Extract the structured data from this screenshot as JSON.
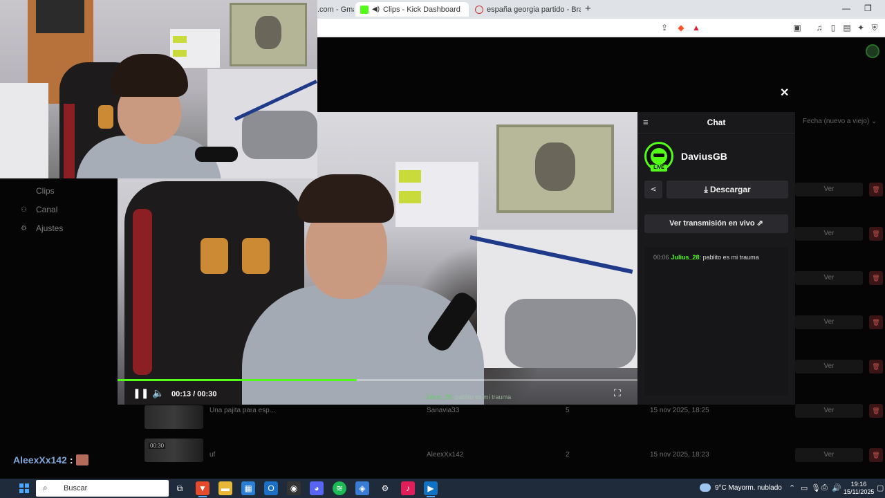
{
  "browser": {
    "tabs": [
      {
        "label": ".com - Gmail",
        "active": false
      },
      {
        "label": "Clips - Kick Dashboard",
        "active": true
      },
      {
        "label": "españa georgia partido - Brave Search",
        "active": false
      }
    ]
  },
  "sidebar": {
    "items": [
      {
        "label": "Clips",
        "icon": "clips-icon"
      },
      {
        "label": "Canal",
        "icon": "people-icon"
      },
      {
        "label": "Ajustes",
        "icon": "gear-icon"
      }
    ]
  },
  "table": {
    "sort_label": "Fecha (nuevo a viejo)",
    "view_label": "Ver",
    "rows": [
      {
        "thumb_time": "",
        "title": "Una pajita para esp...",
        "author": "Sanavia33",
        "views": "5",
        "date": "15 nov 2025, 18:25"
      },
      {
        "thumb_time": "00:30",
        "title": "uf",
        "author": "AleexXx142",
        "views": "2",
        "date": "15 nov 2025, 18:23"
      }
    ]
  },
  "player": {
    "time": "00:13 / 00:30",
    "progress": 0.46,
    "overlay_user": "Julius_28:",
    "overlay_text": "pablito es mi trauma"
  },
  "chat": {
    "title": "Chat",
    "streamer": "DaviusGB",
    "live_badge": "LIVE",
    "download_label": "Descargar",
    "live_button_label": "Ver transmisión en vivo",
    "messages": [
      {
        "time": "00:06",
        "user": "Julius_28",
        "text": ": pablito es mi trauma"
      }
    ]
  },
  "stream_overlay": {
    "viewer": "AleexXx142",
    "colon": ":"
  },
  "taskbar": {
    "search_placeholder": "Buscar",
    "weather": "9°C  Mayorm. nublado",
    "time": "19:16",
    "date": "15/11/2025"
  },
  "colors": {
    "accent": "#53fc18",
    "viewer_name": "#7fa7d9",
    "delete": "#c05050"
  }
}
